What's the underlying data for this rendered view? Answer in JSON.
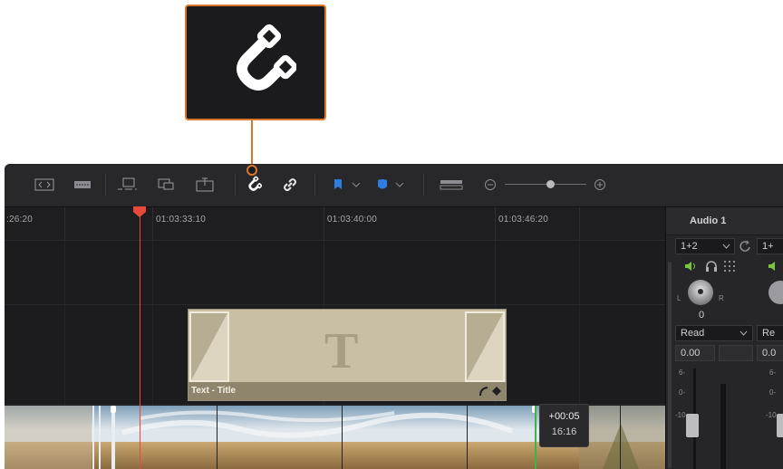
{
  "callout": {
    "icon": "magnet-icon",
    "accent": "#d8772c"
  },
  "toolbar": {
    "icons": [
      "trim-mode-icon",
      "dynamic-trim-icon",
      "blade-icon",
      "insert-icon",
      "overwrite-icon",
      "replace-icon",
      "snapping-icon",
      "linked-selection-icon",
      "flag-icon",
      "marker-icon",
      "timeline-view-icon",
      "zoom-out-icon",
      "zoom-in-icon"
    ],
    "flag_color": "#2f7de1",
    "marker_color": "#2f7de1"
  },
  "ruler": {
    "timecodes": [
      ":26:20",
      "01:03:33:10",
      "01:03:40:00",
      "01:03:46:20"
    ]
  },
  "title_clip": {
    "label": "Text - Title",
    "glyph": "T"
  },
  "edit_tooltip": {
    "offset": "+00:05",
    "duration": "16:16"
  },
  "mixer": {
    "channel1": {
      "name": "Audio 1",
      "input": "1+2",
      "pan_value": "0",
      "pan_left": "L",
      "pan_right": "R",
      "automation": "Read",
      "level": "0.00",
      "scale": [
        "6-",
        "0-",
        "-10-"
      ]
    },
    "channel2": {
      "input": "1+",
      "automation": "Re",
      "level": "0.0",
      "scale": [
        "6-",
        "0-",
        "-10-"
      ]
    }
  },
  "colors": {
    "playhead": "#e8493b",
    "edit_point": "#3fb24a",
    "speaker": "#7cc63f"
  }
}
